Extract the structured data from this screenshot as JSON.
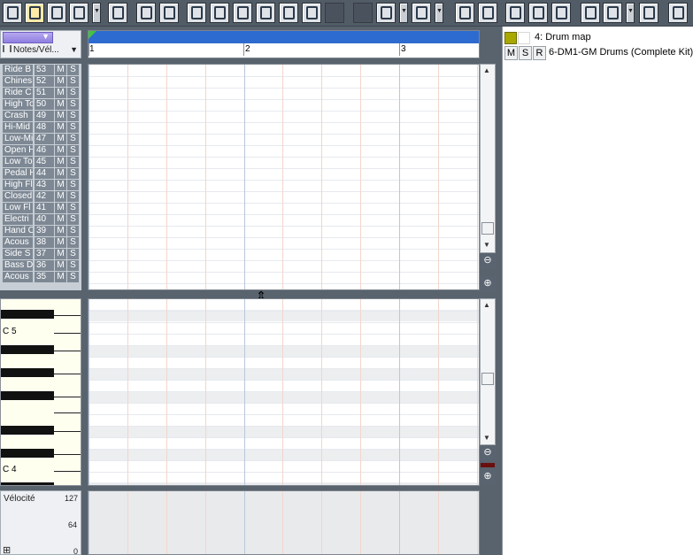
{
  "toolbar": {
    "buttons": [
      {
        "name": "select-tool-button",
        "icon": "arrow-cursor-icon"
      },
      {
        "name": "draw-tool-button",
        "icon": "pencil-icon",
        "active": true
      },
      {
        "name": "erase-tool-button",
        "icon": "eraser-icon"
      },
      {
        "name": "brush-tool-button",
        "icon": "brush-icon"
      },
      {
        "name": "mute-tool-button",
        "icon": "mute-icon"
      },
      {
        "name": "snap-button",
        "icon": "snap-icon"
      },
      {
        "name": "grid-resolution-button",
        "icon": "ruler-icon"
      },
      {
        "name": "whole-note-button",
        "icon": "whole-note-icon"
      },
      {
        "name": "half-note-button",
        "icon": "half-note-icon"
      },
      {
        "name": "quarter-note-button",
        "icon": "quarter-note-icon"
      },
      {
        "name": "eighth-note-button",
        "icon": "eighth-note-icon"
      },
      {
        "name": "sixteenth-note-button",
        "icon": "sixteenth-note-icon"
      },
      {
        "name": "thirtysecond-note-button",
        "icon": "thirtysecond-note-icon"
      },
      {
        "name": "snap-grid-button",
        "icon": "grid-icon"
      },
      {
        "name": "sort-order-button",
        "icon": "sort-arrows-icon"
      },
      {
        "name": "view-left-button",
        "icon": "view-left-icon"
      },
      {
        "name": "view-bottom-button",
        "icon": "view-bottom-icon"
      },
      {
        "name": "layout-a-button",
        "icon": "layout-a-icon"
      },
      {
        "name": "layout-b-button",
        "icon": "layout-b-icon"
      },
      {
        "name": "layout-c-button",
        "icon": "layout-c-icon"
      },
      {
        "name": "inspector-toggle-button",
        "icon": "inspector-icon"
      },
      {
        "name": "track-view-button",
        "icon": "track-view-icon"
      },
      {
        "name": "playback-button",
        "icon": "playback-icon"
      },
      {
        "name": "zoom-search-button",
        "icon": "magnifier-icon"
      }
    ]
  },
  "inspector": {
    "title": "4: Drum map",
    "m": "M",
    "s": "S",
    "r": "R",
    "track_name": "6-DM1-GM Drums (Complete Kit)*",
    "swatch_color": "#a8a800"
  },
  "left_header": {
    "notes_label": "Notes/Vél...",
    "notes_arrow": "▼",
    "purple_arrow": "▼"
  },
  "ruler": {
    "bars": [
      "1",
      "2",
      "3"
    ]
  },
  "drum_list": [
    {
      "name": "Ride B",
      "note": "53"
    },
    {
      "name": "Chines",
      "note": "52"
    },
    {
      "name": "Ride C",
      "note": "51"
    },
    {
      "name": "High To",
      "note": "50"
    },
    {
      "name": "Crash",
      "note": "49"
    },
    {
      "name": "Hi-Mid",
      "note": "48"
    },
    {
      "name": "Low-Mi",
      "note": "47"
    },
    {
      "name": "Open H",
      "note": "46"
    },
    {
      "name": "Low To",
      "note": "45"
    },
    {
      "name": "Pedal H",
      "note": "44"
    },
    {
      "name": "High Fl",
      "note": "43"
    },
    {
      "name": "Closed",
      "note": "42"
    },
    {
      "name": "Low Fl",
      "note": "41"
    },
    {
      "name": "Electri",
      "note": "40"
    },
    {
      "name": "Hand C",
      "note": "39"
    },
    {
      "name": "Acous",
      "note": "38"
    },
    {
      "name": "Side S",
      "note": "37"
    },
    {
      "name": "Bass D",
      "note": "36"
    },
    {
      "name": "Acous",
      "note": "35"
    }
  ],
  "drum_row_m": "M",
  "drum_row_s": "S",
  "piano": {
    "label_c5": "C 5",
    "label_c4": "C 4"
  },
  "velocity": {
    "label": "Vélocité",
    "max": "127",
    "mid": "64",
    "min": "0",
    "expand": "⊞"
  },
  "scroll": {
    "up": "▲",
    "down": "▼",
    "zoom_out": "⊖",
    "zoom_in": "⊕"
  },
  "splitter_glyph": "⇕"
}
